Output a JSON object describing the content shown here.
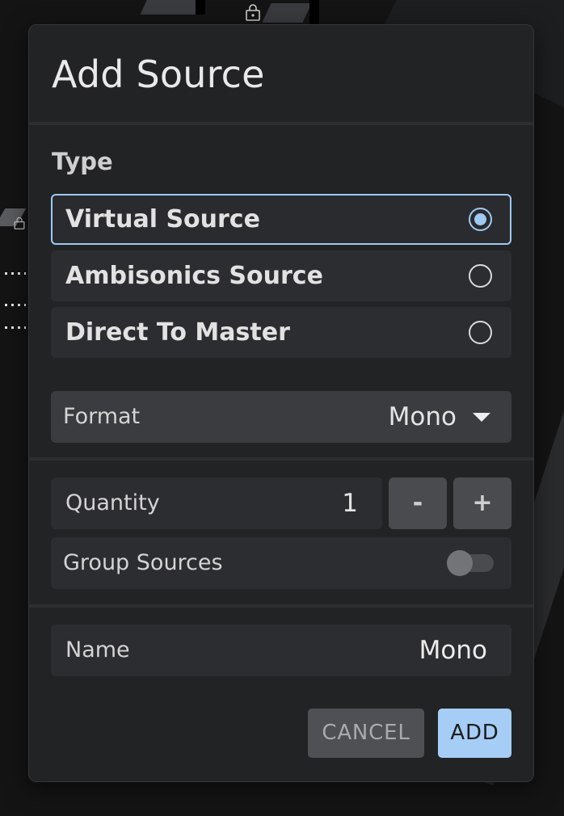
{
  "dialog": {
    "title": "Add Source"
  },
  "type_section": {
    "label": "Type",
    "options": [
      {
        "label": "Virtual Source",
        "selected": true
      },
      {
        "label": "Ambisonics Source",
        "selected": false
      },
      {
        "label": "Direct To Master",
        "selected": false
      }
    ]
  },
  "format": {
    "label": "Format",
    "value": "Mono",
    "icon": "chevron-down-icon"
  },
  "quantity": {
    "label": "Quantity",
    "value": "1",
    "decrement_label": "-",
    "increment_label": "+"
  },
  "group_sources": {
    "label": "Group Sources",
    "enabled": false
  },
  "name": {
    "label": "Name",
    "value": "Mono"
  },
  "actions": {
    "cancel_label": "CANCEL",
    "add_label": "ADD"
  },
  "colors": {
    "accent": "#9fc9f2",
    "dialog_background": "#222325",
    "add_button": "#a6cdf5",
    "cancel_button": "#4f5054"
  }
}
